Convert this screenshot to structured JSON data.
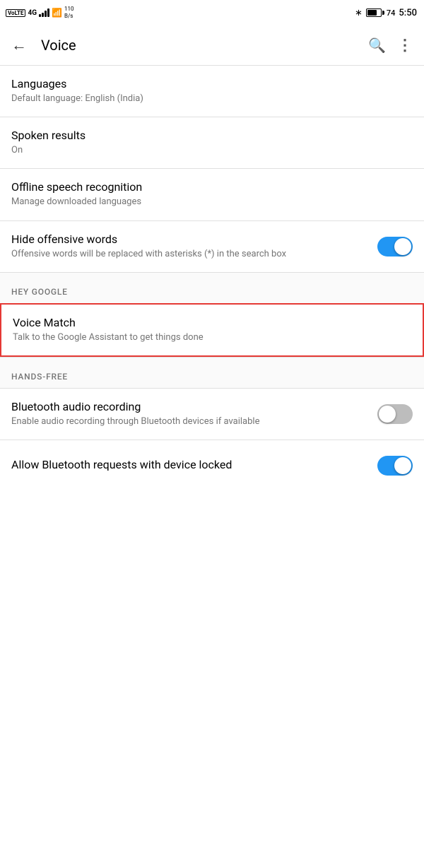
{
  "statusBar": {
    "left": {
      "volte": "VoLTE",
      "signal4g": "4G",
      "speed": "110\nB/s"
    },
    "right": {
      "bluetooth": "⚡",
      "batteryPercent": "74",
      "time": "5:50"
    }
  },
  "appBar": {
    "title": "Voice",
    "backLabel": "←",
    "searchLabel": "🔍",
    "moreLabel": "⋮"
  },
  "settings": {
    "items": [
      {
        "id": "languages",
        "title": "Languages",
        "subtitle": "Default language: English (India)",
        "hasToggle": false
      },
      {
        "id": "spoken-results",
        "title": "Spoken results",
        "subtitle": "On",
        "hasToggle": false
      },
      {
        "id": "offline-speech",
        "title": "Offline speech recognition",
        "subtitle": "Manage downloaded languages",
        "hasToggle": false
      },
      {
        "id": "hide-offensive",
        "title": "Hide offensive words",
        "subtitle": "Offensive words will be replaced with asterisks (*) in the search box",
        "hasToggle": true,
        "toggleOn": true
      }
    ],
    "sections": [
      {
        "id": "hey-google",
        "header": "HEY GOOGLE",
        "items": [
          {
            "id": "voice-match",
            "title": "Voice Match",
            "subtitle": "Talk to the Google Assistant to get things done",
            "hasToggle": false,
            "highlighted": true
          }
        ]
      },
      {
        "id": "hands-free",
        "header": "HANDS-FREE",
        "items": [
          {
            "id": "bluetooth-audio",
            "title": "Bluetooth audio recording",
            "subtitle": "Enable audio recording through Bluetooth devices if available",
            "hasToggle": true,
            "toggleOn": false
          },
          {
            "id": "bluetooth-requests",
            "title": "Allow Bluetooth requests with device locked",
            "subtitle": "",
            "hasToggle": true,
            "toggleOn": true
          }
        ]
      }
    ]
  }
}
